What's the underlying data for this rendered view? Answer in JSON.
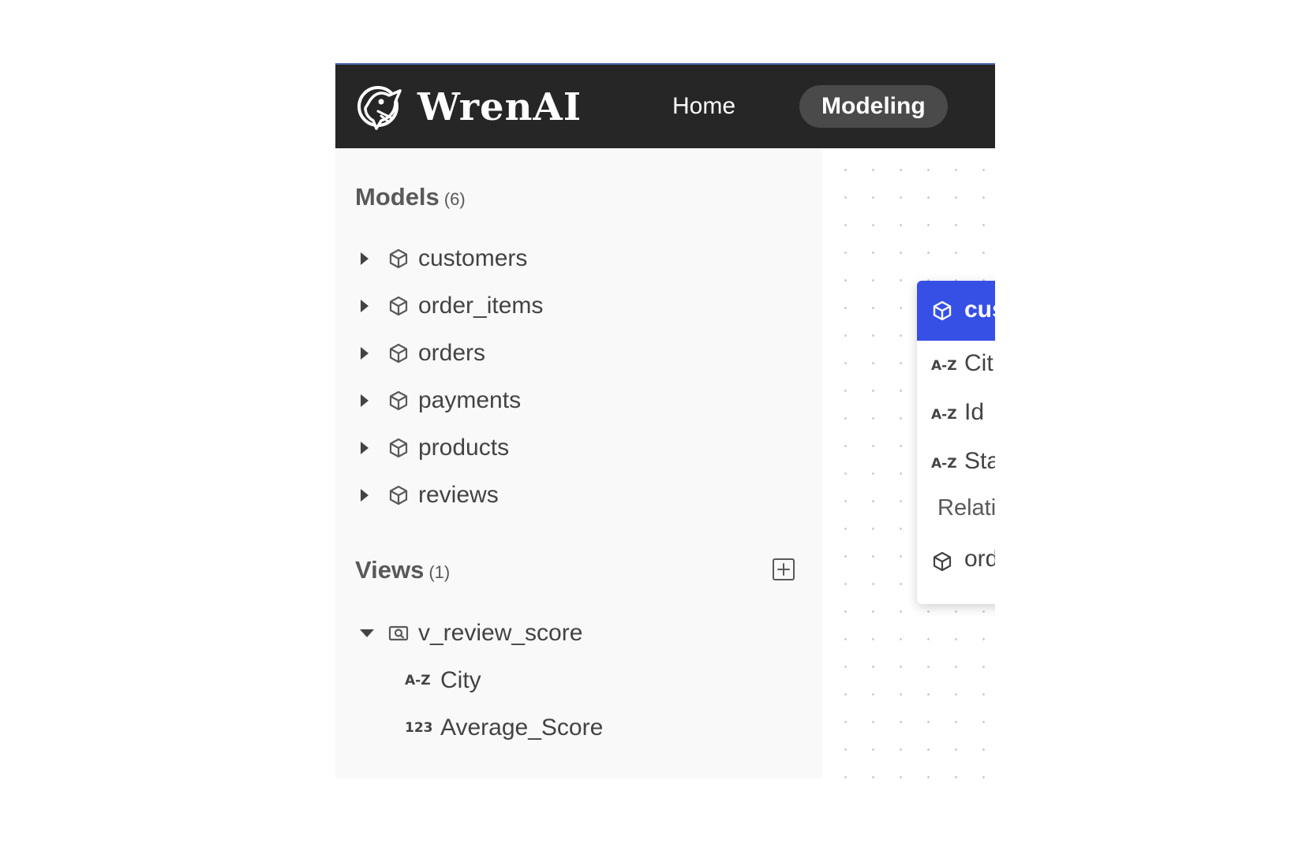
{
  "app": {
    "brand": "WrenAI",
    "colors": {
      "header_bg": "#262626",
      "accent": "#3650e6",
      "sidebar_bg": "#f9f9f9"
    }
  },
  "nav": {
    "home_label": "Home",
    "modeling_label": "Modeling"
  },
  "sidebar": {
    "models": {
      "title": "Models",
      "count": "(6)",
      "items": [
        {
          "label": "customers",
          "icon": "cube-icon",
          "expanded": false
        },
        {
          "label": "order_items",
          "icon": "cube-icon",
          "expanded": false
        },
        {
          "label": "orders",
          "icon": "cube-icon",
          "expanded": false
        },
        {
          "label": "payments",
          "icon": "cube-icon",
          "expanded": false
        },
        {
          "label": "products",
          "icon": "cube-icon",
          "expanded": false
        },
        {
          "label": "reviews",
          "icon": "cube-icon",
          "expanded": false
        }
      ]
    },
    "views": {
      "title": "Views",
      "count": "(1)",
      "items": [
        {
          "label": "v_review_score",
          "icon": "view-icon",
          "expanded": true,
          "columns": [
            {
              "type_label": "A-Z",
              "label": "City"
            },
            {
              "type_label": "123",
              "label": "Average_Score"
            }
          ]
        }
      ]
    }
  },
  "canvas": {
    "node": {
      "title": "cus",
      "columns": [
        {
          "type_label": "A-Z",
          "label": "Cit"
        },
        {
          "type_label": "A-Z",
          "label": "Id"
        },
        {
          "type_label": "A-Z",
          "label": "Sta"
        }
      ],
      "relationships_label": "Relati",
      "relationships": [
        {
          "label": "ord"
        }
      ]
    }
  }
}
